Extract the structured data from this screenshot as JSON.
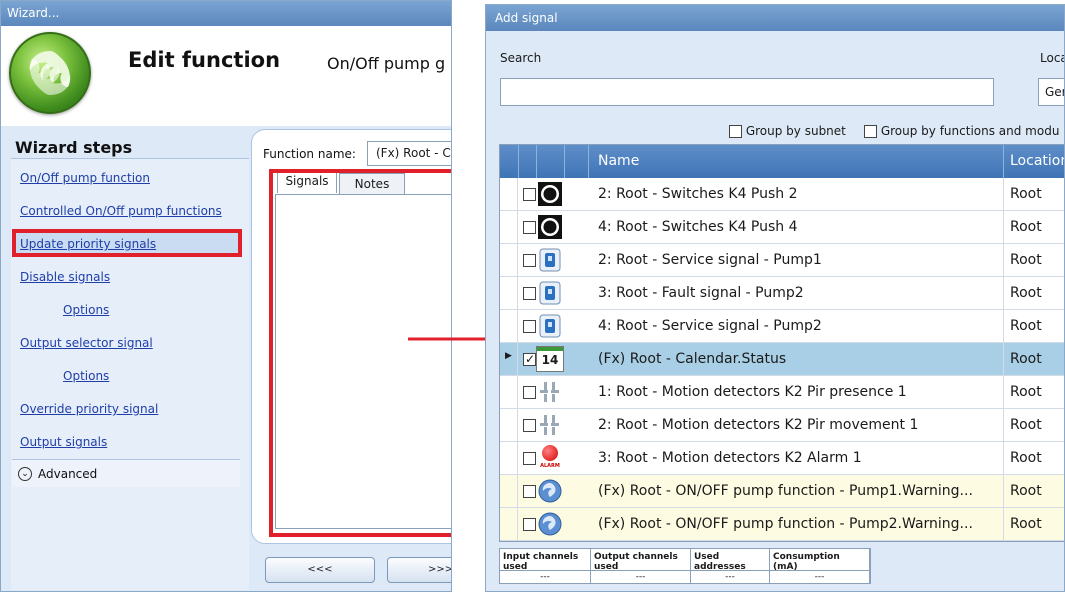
{
  "wizard": {
    "window_title": "Wizard...",
    "title": "Edit function",
    "subtitle": "On/Off pump g",
    "steps_title": "Wizard steps",
    "steps": [
      {
        "label": "On/Off pump function"
      },
      {
        "label": "Controlled On/Off pump functions"
      },
      {
        "label": "Update priority signals",
        "highlighted": true
      },
      {
        "label": "Disable signals"
      },
      {
        "label": "Options"
      },
      {
        "label": "Output selector signal"
      },
      {
        "label": "Options"
      },
      {
        "label": "Override priority signal"
      },
      {
        "label": "Output signals"
      }
    ],
    "advanced_label": "Advanced",
    "function_name_label": "Function name:",
    "function_name_value": "(Fx) Root - C",
    "tabs": [
      {
        "label": "Signals",
        "active": true
      },
      {
        "label": "Notes",
        "active": false
      }
    ],
    "prev_button": "<<<",
    "next_button": ">>>"
  },
  "add_signal": {
    "window_title": "Add signal",
    "search_label": "Search",
    "location_label": "Loca",
    "location_value": "Ger",
    "group_by_subnet": "Group by subnet",
    "group_by_functions": "Group by functions and modu",
    "columns": {
      "name": "Name",
      "location": "Location"
    },
    "rows": [
      {
        "name": "2: Root - Switches K4 Push 2",
        "location": "Root",
        "icon": "push-button-icon",
        "checked": false
      },
      {
        "name": "4: Root - Switches K4 Push 4",
        "location": "Root",
        "icon": "push-button-icon",
        "checked": false
      },
      {
        "name": "2: Root - Service signal - Pump1",
        "location": "Root",
        "icon": "service-signal-icon",
        "checked": false
      },
      {
        "name": "3: Root - Fault signal - Pump2",
        "location": "Root",
        "icon": "fault-signal-icon",
        "checked": false
      },
      {
        "name": "4: Root - Service signal - Pump2",
        "location": "Root",
        "icon": "service-signal-icon",
        "checked": false
      },
      {
        "name": "(Fx) Root - Calendar.Status",
        "location": "Root",
        "icon": "calendar-icon",
        "icon_text": "14",
        "checked": true,
        "selected": true
      },
      {
        "name": "1: Root - Motion detectors K2 Pir presence 1",
        "location": "Root",
        "icon": "motion-detector-icon",
        "checked": false
      },
      {
        "name": "2: Root - Motion detectors K2 Pir movement 1",
        "location": "Root",
        "icon": "motion-detector-icon",
        "checked": false
      },
      {
        "name": "3: Root - Motion detectors K2 Alarm 1",
        "location": "Root",
        "icon": "alarm-icon",
        "icon_text": "ALARM",
        "checked": false
      },
      {
        "name": "(Fx) Root - ON/OFF pump function - Pump1.Warning...",
        "location": "Root",
        "icon": "pump-function-icon",
        "checked": false,
        "fx": true
      },
      {
        "name": "(Fx) Root - ON/OFF pump function - Pump2.Warning...",
        "location": "Root",
        "icon": "pump-function-icon",
        "checked": false,
        "fx": true
      }
    ],
    "stats": [
      {
        "label": "Input channels used",
        "value": "---"
      },
      {
        "label": "Output channels used",
        "value": "---"
      },
      {
        "label": "Used addresses",
        "value": "---"
      },
      {
        "label": "Consumption (mA)",
        "value": "---"
      }
    ]
  },
  "colors": {
    "highlight_red": "#e0202a",
    "title_bar_blue": "#5b87bd",
    "grid_header_blue": "#3f74b5",
    "selected_row": "#a9cfe6",
    "fx_row": "#fdfbe2",
    "link_blue": "#1f3ea8"
  }
}
